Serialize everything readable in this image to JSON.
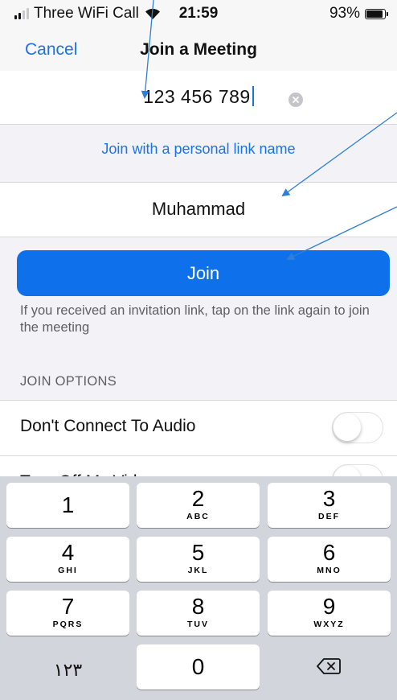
{
  "status": {
    "carrier": "Three WiFi Call",
    "time": "21:59",
    "battery": "93%",
    "battery_level": 0.93
  },
  "nav": {
    "cancel": "Cancel",
    "title": "Join a Meeting"
  },
  "meeting_id": {
    "value": "123 456 789"
  },
  "personal_link": "Join with a personal link name",
  "name_field": {
    "value": "Muhammad"
  },
  "join_button": "Join",
  "hint": "If you received an invitation link, tap on the link again to join the meeting",
  "options": {
    "header": "JOIN OPTIONS",
    "items": [
      {
        "label": "Don't Connect To Audio",
        "on": false
      },
      {
        "label": "Turn Off My Video",
        "on": false
      }
    ]
  },
  "keypad": [
    {
      "num": "1",
      "letters": ""
    },
    {
      "num": "2",
      "letters": "ABC"
    },
    {
      "num": "3",
      "letters": "DEF"
    },
    {
      "num": "4",
      "letters": "GHI"
    },
    {
      "num": "5",
      "letters": "JKL"
    },
    {
      "num": "6",
      "letters": "MNO"
    },
    {
      "num": "7",
      "letters": "PQRS"
    },
    {
      "num": "8",
      "letters": "TUV"
    },
    {
      "num": "9",
      "letters": "WXYZ"
    },
    {
      "num": "١٢٣",
      "letters": ""
    },
    {
      "num": "0",
      "letters": ""
    }
  ],
  "icons": {
    "clear": "clear-circle-icon",
    "delete": "backspace-icon",
    "wifi": "wifi-icon",
    "signal": "cellular-signal-icon",
    "battery": "battery-icon"
  },
  "colors": {
    "accent": "#1a73e8",
    "join_button": "#0e71eb",
    "keyboard_bg": "#d2d5db",
    "annotation": "#2f7fd8"
  }
}
